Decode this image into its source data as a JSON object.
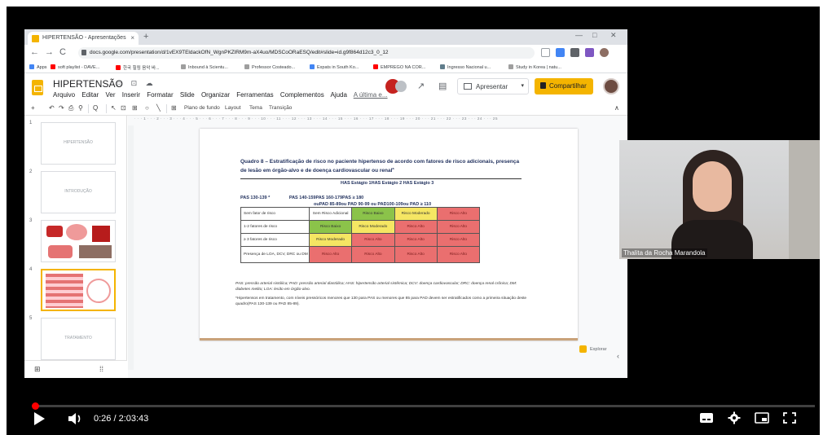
{
  "browser": {
    "tab_title": "HIPERTENSÃO - Apresentações",
    "tab_close": "×",
    "new_tab": "+",
    "win_min": "—",
    "win_max": "□",
    "win_close": "✕",
    "nav_back": "←",
    "nav_forward": "→",
    "nav_reload": "C",
    "url": "docs.google.com/presentation/d/1vEX9TEldackOfN_WgnPKZlRM9m-aX4uo/MDSCoORaESQ/edit#slide=id.g9f864d12c3_0_12",
    "bookmarks": [
      "Apps",
      "soft playlist - DAVE...",
      "한국 힐링 음악 바...",
      "Inbound à Scientu...",
      "Professor Costeado...",
      "Expats in South Ko...",
      "EMPREGO NA COR...",
      "Ingresso Nacional u...",
      "Study in Korea | natu..."
    ]
  },
  "app": {
    "doc_title": "HIPERTENSÃO",
    "title_icons": "☆ ⊡ ☁",
    "menu": [
      "Arquivo",
      "Editar",
      "Ver",
      "Inserir",
      "Formatar",
      "Slide",
      "Organizar",
      "Ferramentas",
      "Complementos",
      "Ajuda"
    ],
    "last_edit": "A última e...",
    "present_label": "Apresentar",
    "share_label": "Compartilhar",
    "toolbar": {
      "new": "+",
      "undo": "↶",
      "redo": "↷",
      "print": "⎙",
      "paint": "⚲",
      "zoom": "Q",
      "cursor": "↖",
      "textbox": "⊡",
      "image": "⊞",
      "shape": "○",
      "line": "╲",
      "comment": "⊞",
      "background": "Plano de fundo",
      "layout": "Layout",
      "theme": "Tema",
      "transition": "Transição",
      "collapse": "∧"
    },
    "ruler": "· · · 1 · · · 2 · · · 3 · · · 4 · · · 5 · · · 6 · · · 7 · · · 8 · · · 9 · · · 10 · · · 11 · · · 12 · · · 13 · · · 14 · · · 15 · · · 16 · · · 17 · · · 18 · · · 19 · · · 20 · · · 21 · · · 22 · · · 23 · · · 24 · · · 25"
  },
  "filmstrip": {
    "thumbs": [
      {
        "num": "1",
        "title": "HIPERTENSÃO"
      },
      {
        "num": "2",
        "title": "INTRODUÇÃO"
      },
      {
        "num": "3",
        "title": ""
      },
      {
        "num": "4",
        "title": ""
      },
      {
        "num": "5",
        "title": "TRATAMENTO"
      }
    ],
    "grid_btn": "⊞",
    "list_btn": "⁞⁞"
  },
  "slide": {
    "title": "Quadro 8 – Estratificação de risco no paciente hipertenso de acordo com fatores de risco adicionais, presença de lesão em órgão-alvo e de doença cardiovascular ou renal",
    "title_sup": "a",
    "has_header": "HAS Estágio 1HAS Estágio 2 HAS Estágio 3",
    "pas_row1": [
      "PAS 130-139 *",
      "PAS 140-159PAS 160-179PAS ≥ 180"
    ],
    "pas_row2": "ouPAD 85-89ou PAD 90-99 ou PAD100-109ou PAD ≥ 110",
    "table": [
      {
        "label": "Sem fator de risco",
        "cells": [
          {
            "text": "Sem Risco Adicional",
            "color": "white"
          },
          {
            "text": "Risco Baixo",
            "color": "green"
          },
          {
            "text": "Risco Moderado",
            "color": "yellow"
          },
          {
            "text": "Risco Alto",
            "color": "red"
          }
        ]
      },
      {
        "label": "1-2 fatores de risco",
        "cells": [
          {
            "text": "Risco Baixo",
            "color": "green"
          },
          {
            "text": "Risco Moderado",
            "color": "yellow"
          },
          {
            "text": "Risco Alto",
            "color": "red"
          },
          {
            "text": "Risco Alto",
            "color": "red"
          }
        ]
      },
      {
        "label": "≥ 3 fatores de risco",
        "cells": [
          {
            "text": "Risco Moderado",
            "color": "yellow"
          },
          {
            "text": "Risco Alto",
            "color": "red"
          },
          {
            "text": "Risco Alto",
            "color": "red"
          },
          {
            "text": "Risco Alto",
            "color": "red"
          }
        ]
      },
      {
        "label": "Presença de LOA, DCV, DRC ou DM",
        "cells": [
          {
            "text": "Risco Alto",
            "color": "red"
          },
          {
            "text": "Risco Alto",
            "color": "red"
          },
          {
            "text": "Risco Alto",
            "color": "red"
          },
          {
            "text": "Risco Alto",
            "color": "red"
          }
        ]
      }
    ],
    "footnote": "PAS: pressão arterial sistólica; PAD: pressão arterial diastólica; HAS: hipertensão arterial sistêmica; DCV: doença cardiovascular; DRC: doença renal crônica; DM: diabetes melito; LOA: lesão em órgão-alvo.",
    "footnote2": "*Hipertensos em tratamento, com níveis pressóricos menores que 130 para PAS ou menores que 85 para PAD devem ser estratificados como a primeira situação deste quadro(PAS 130-139 ou PAD 85-89).",
    "explore_label": "Explorar"
  },
  "webcam": {
    "name": "Thalita da Rocha Marandola"
  },
  "player": {
    "time": "0:26 / 2:03:43",
    "progress": 0.0035
  },
  "colors": {
    "green": "#8bc34a",
    "yellow": "#f5e663",
    "red": "#ea6f6f",
    "slides_yellow": "#f4b400",
    "yt_red": "#ff0000"
  }
}
